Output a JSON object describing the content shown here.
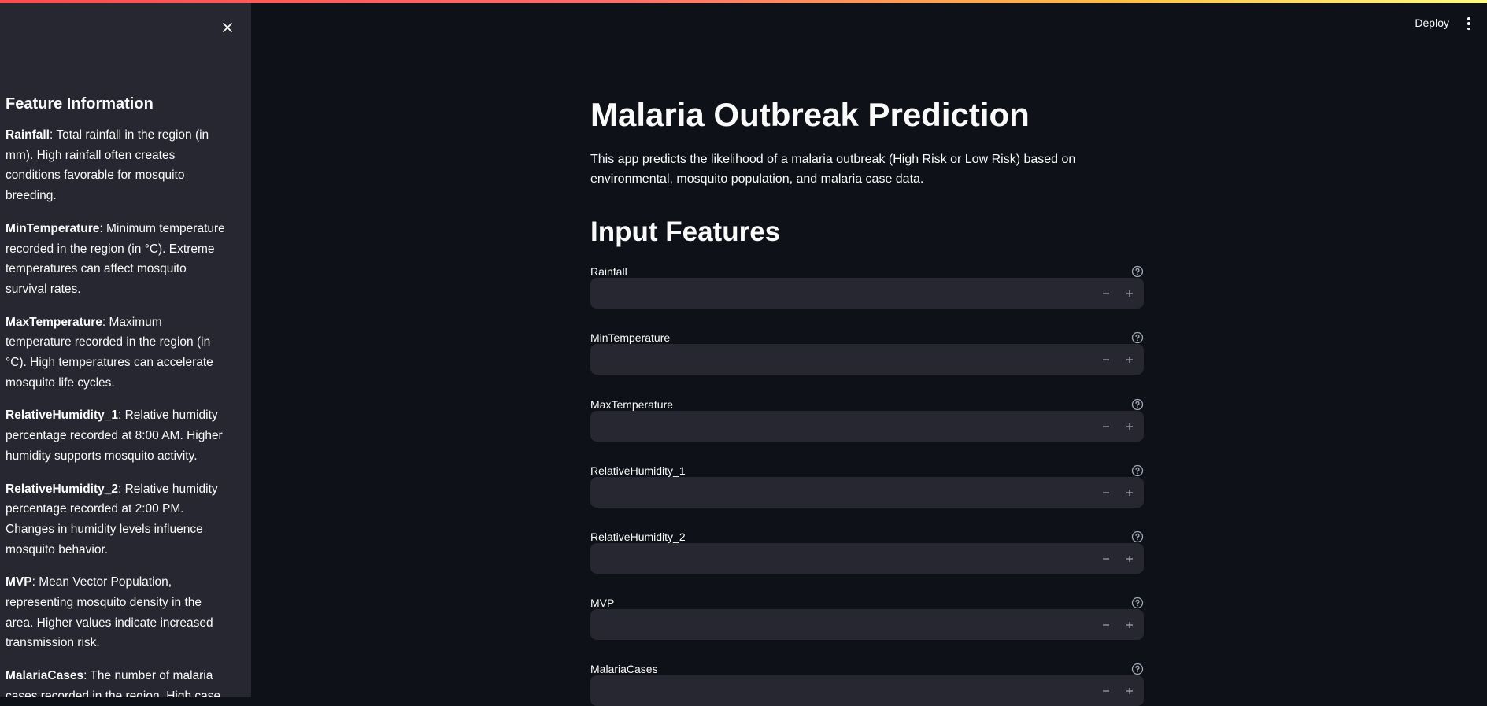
{
  "header": {
    "deploy_label": "Deploy"
  },
  "icons": {
    "close": "close-icon",
    "menu": "kebab-menu-icon",
    "help": "help-circle-icon",
    "minus": "minus-icon",
    "plus": "plus-icon"
  },
  "sidebar": {
    "title": "Feature Information",
    "items": [
      {
        "name": "Rainfall",
        "text": ": Total rainfall in the region (in mm). High rainfall often creates conditions favorable for mosquito breeding."
      },
      {
        "name": "MinTemperature",
        "text": ": Minimum temperature recorded in the region (in °C). Extreme temperatures can affect mosquito survival rates."
      },
      {
        "name": "MaxTemperature",
        "text": ": Maximum temperature recorded in the region (in °C). High temperatures can accelerate mosquito life cycles."
      },
      {
        "name": "RelativeHumidity_1",
        "text": ": Relative humidity percentage recorded at 8:00 AM. Higher humidity supports mosquito activity."
      },
      {
        "name": "RelativeHumidity_2",
        "text": ": Relative humidity percentage recorded at 2:00 PM. Changes in humidity levels influence mosquito behavior."
      },
      {
        "name": "MVP",
        "text": ": Mean Vector Population, representing mosquito density in the area. Higher values indicate increased transmission risk."
      },
      {
        "name": "MalariaCases",
        "text": ": The number of malaria cases recorded in the region. High case"
      }
    ]
  },
  "main": {
    "title": "Malaria Outbreak Prediction",
    "description": "This app predicts the likelihood of a malaria outbreak (High Risk or Low Risk) based on environmental, mosquito population, and malaria case data.",
    "section_title": "Input Features",
    "fields": [
      {
        "label": "Rainfall",
        "value": ""
      },
      {
        "label": "MinTemperature",
        "value": ""
      },
      {
        "label": "MaxTemperature",
        "value": ""
      },
      {
        "label": "RelativeHumidity_1",
        "value": ""
      },
      {
        "label": "RelativeHumidity_2",
        "value": ""
      },
      {
        "label": "MVP",
        "value": ""
      },
      {
        "label": "MalariaCases",
        "value": ""
      }
    ]
  }
}
